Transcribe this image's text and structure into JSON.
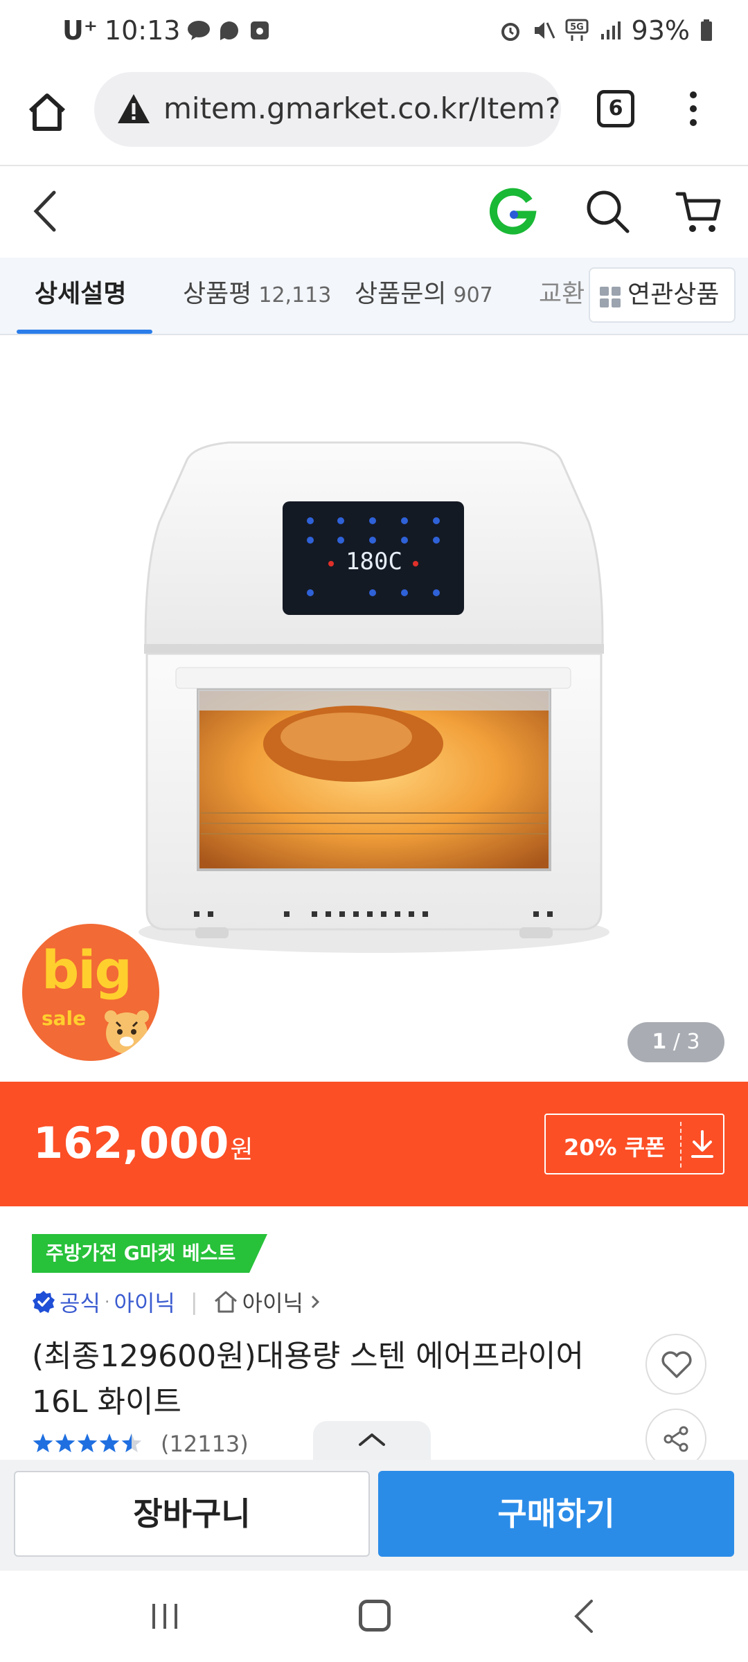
{
  "status_bar": {
    "carrier": "U⁺",
    "time": "10:13",
    "battery": "93%"
  },
  "browser": {
    "url": "mitem.gmarket.co.kr/Item?",
    "tab_count": "6"
  },
  "tabs": {
    "detail": "상세설명",
    "review": "상품평",
    "review_count": "12,113",
    "qna": "상품문의",
    "qna_count": "907",
    "exchange": "교환",
    "related": "연관상품"
  },
  "product_image": {
    "badge_big": "big",
    "badge_sale": "sale",
    "counter_current": "1",
    "counter_sep": " / ",
    "counter_total": "3"
  },
  "price": {
    "amount": "162,000",
    "unit": "원",
    "coupon_label": "20% 쿠폰"
  },
  "info": {
    "best_badge": "주방가전 G마켓 베스트",
    "official": "공식",
    "official_brand": "아이닉",
    "store": "아이닉",
    "title": "(최종129600원)대용량 스텐 에어프라이어 16L 화이트",
    "rating": 4.5,
    "rating_count": "(12113)"
  },
  "bottom": {
    "cart_label": "장바구니",
    "buy_label": "구매하기"
  },
  "colors": {
    "accent": "#fc4f26",
    "primary": "#2b8ce8",
    "badge_green": "#28c13a",
    "official_blue": "#3a5bd0",
    "star": "#1f6fe0"
  },
  "icons": [
    "home-icon",
    "warning-icon",
    "more-icon",
    "back-icon",
    "gmarket-logo",
    "search-icon",
    "cart-icon",
    "grid-icon",
    "download-icon",
    "verified-check-icon",
    "store-house-icon",
    "chevron-right-icon",
    "heart-icon",
    "share-icon",
    "chevron-up-icon"
  ]
}
